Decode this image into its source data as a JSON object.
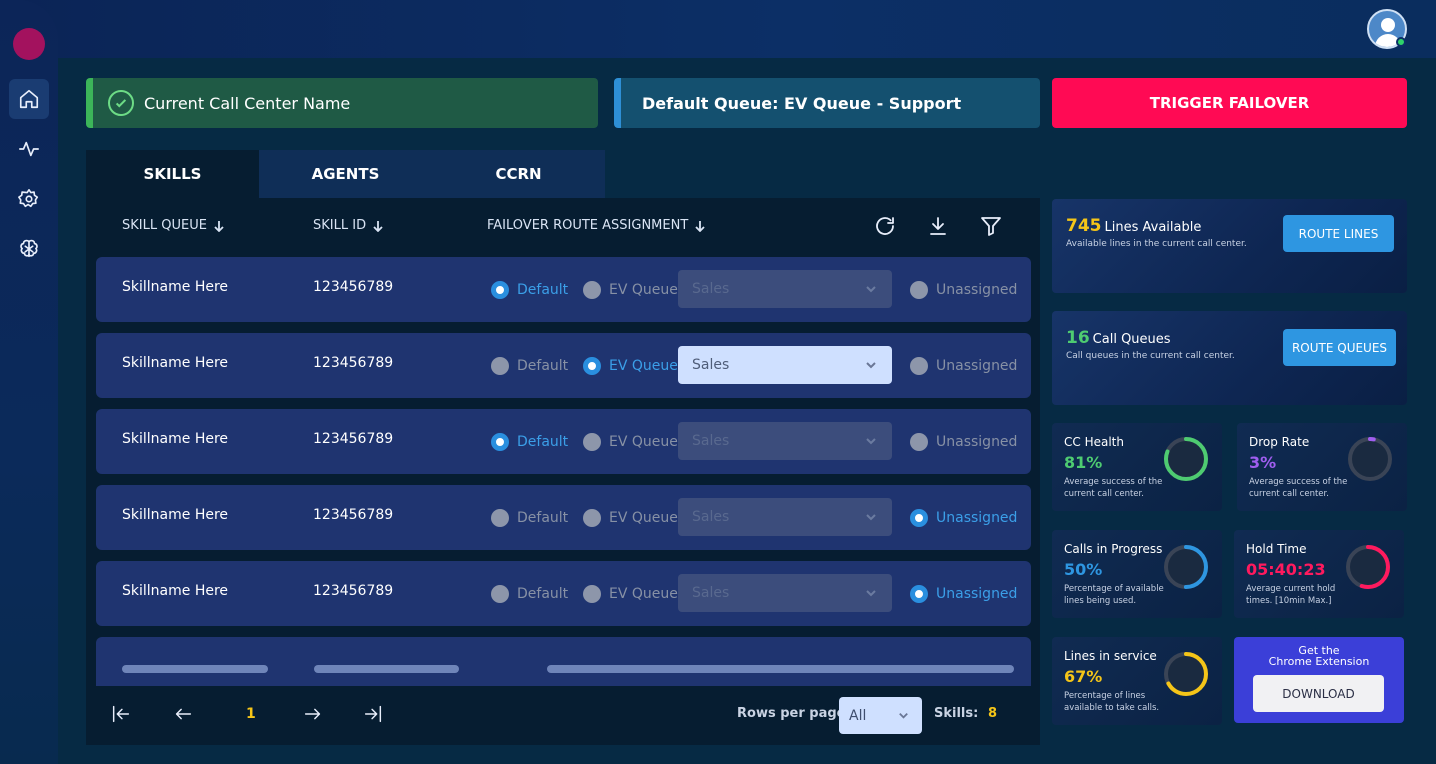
{
  "banners": {
    "call_center_name": "Current Call Center Name",
    "default_queue": "Default Queue: EV Queue - Support",
    "failover_button": "TRIGGER FAILOVER"
  },
  "tabs": [
    {
      "label": "SKILLS",
      "active": true
    },
    {
      "label": "AGENTS",
      "active": false
    },
    {
      "label": "CCRN",
      "active": false
    }
  ],
  "table": {
    "columns": {
      "skill_queue": "SKILL QUEUE",
      "skill_id": "SKILL ID",
      "failover": "FAILOVER ROUTE ASSIGNMENT"
    },
    "radio_labels": {
      "default": "Default",
      "ev_queue": "EV Queue",
      "unassigned": "Unassigned"
    },
    "rows": [
      {
        "name": "Skillname Here",
        "id": "123456789",
        "selected": "default",
        "select_value": "Sales"
      },
      {
        "name": "Skillname Here",
        "id": "123456789",
        "selected": "ev_queue",
        "select_value": "Sales"
      },
      {
        "name": "Skillname Here",
        "id": "123456789",
        "selected": "default",
        "select_value": "Sales"
      },
      {
        "name": "Skillname Here",
        "id": "123456789",
        "selected": "unassigned",
        "select_value": "Sales"
      },
      {
        "name": "Skillname Here",
        "id": "123456789",
        "selected": "unassigned",
        "select_value": "Sales"
      }
    ]
  },
  "pager": {
    "page": "1",
    "rows_per_page_label": "Rows per page:",
    "rows_per_page_value": "All",
    "skills_label": "Skills:",
    "skills_count": "8"
  },
  "stats": {
    "lines": {
      "value": "745",
      "label": "Lines Available",
      "sub": "Available lines in the current call center.",
      "button": "ROUTE LINES"
    },
    "queues": {
      "value": "16",
      "label": "Call Queues",
      "sub": "Call queues in the current call center.",
      "button": "ROUTE QUEUES"
    }
  },
  "metrics": {
    "cc_health": {
      "title": "CC Health",
      "value": "81%",
      "desc": "Average success of the current call center.",
      "fraction": 0.81,
      "color": "#4ecb71"
    },
    "drop_rate": {
      "title": "Drop Rate",
      "value": "3%",
      "desc": "Average success of the current call center.",
      "fraction": 0.03,
      "color": "#a05ef0"
    },
    "calls_in_progress": {
      "title": "Calls in Progress",
      "value": "50%",
      "desc": "Percentage of available lines being used.",
      "fraction": 0.5,
      "color": "#2e96e1"
    },
    "hold_time": {
      "title": "Hold Time",
      "value": "05:40:23",
      "desc": "Average current hold times. [10min Max.]",
      "fraction": 0.55,
      "color": "#ff1a5e"
    },
    "lines_in_service": {
      "title": "Lines in service",
      "value": "67%",
      "desc": "Percentage of lines available to take calls.",
      "fraction": 0.67,
      "color": "#f5c518"
    }
  },
  "extension": {
    "title_line1": "Get the",
    "title_line2": "Chrome Extension",
    "button": "DOWNLOAD"
  },
  "icons": [
    "home-icon",
    "activity-icon",
    "gear-icon",
    "brain-icon",
    "refresh-icon",
    "download-icon",
    "filter-icon",
    "check-icon",
    "chevron-down-icon",
    "first-page-icon",
    "prev-page-icon",
    "next-page-icon",
    "last-page-icon",
    "avatar-icon"
  ]
}
